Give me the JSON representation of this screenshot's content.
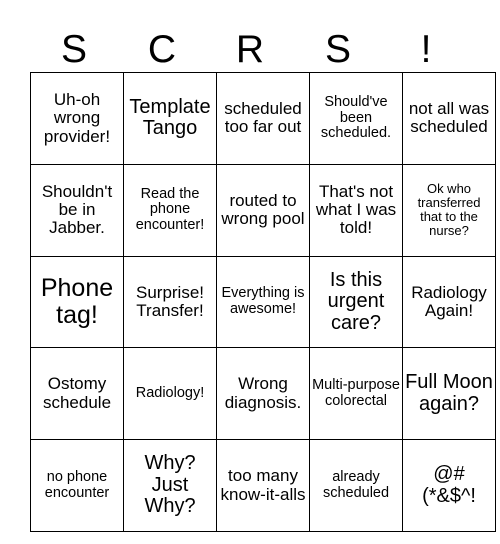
{
  "card": {
    "header": {
      "letters": [
        "S",
        "C",
        "R",
        "S",
        "!"
      ]
    },
    "grid": {
      "rows": 5,
      "columns": 5,
      "cells": [
        [
          {
            "text": "Uh-oh wrong provider!",
            "size": "md"
          },
          {
            "text": "Template Tango",
            "size": "lg"
          },
          {
            "text": "scheduled too far out",
            "size": "md"
          },
          {
            "text": "Should've been scheduled.",
            "size": "sm"
          },
          {
            "text": "not all was scheduled",
            "size": "md"
          }
        ],
        [
          {
            "text": "Shouldn't be in Jabber.",
            "size": "md"
          },
          {
            "text": "Read the phone encounter!",
            "size": "sm"
          },
          {
            "text": "routed to wrong pool",
            "size": "md"
          },
          {
            "text": "That's not what I was told!",
            "size": "md"
          },
          {
            "text": "Ok who transferred that to the nurse?",
            "size": "xs"
          }
        ],
        [
          {
            "text": "Phone tag!",
            "size": "xl"
          },
          {
            "text": "Surprise! Transfer!",
            "size": "md"
          },
          {
            "text": "Everything is awesome!",
            "size": "sm"
          },
          {
            "text": "Is this urgent care?",
            "size": "lg"
          },
          {
            "text": "Radiology Again!",
            "size": "md"
          }
        ],
        [
          {
            "text": "Ostomy schedule",
            "size": "md"
          },
          {
            "text": "Radiology!",
            "size": "sm"
          },
          {
            "text": "Wrong diagnosis.",
            "size": "md"
          },
          {
            "text": "Multi-purpose colorectal",
            "size": "sm"
          },
          {
            "text": "Full Moon again?",
            "size": "lg"
          }
        ],
        [
          {
            "text": "no phone encounter",
            "size": "sm"
          },
          {
            "text": "Why? Just Why?",
            "size": "lg"
          },
          {
            "text": "too many know-it-alls",
            "size": "md"
          },
          {
            "text": "already scheduled",
            "size": "sm"
          },
          {
            "text": "@# (*&$^!",
            "size": "lg"
          }
        ]
      ]
    }
  }
}
